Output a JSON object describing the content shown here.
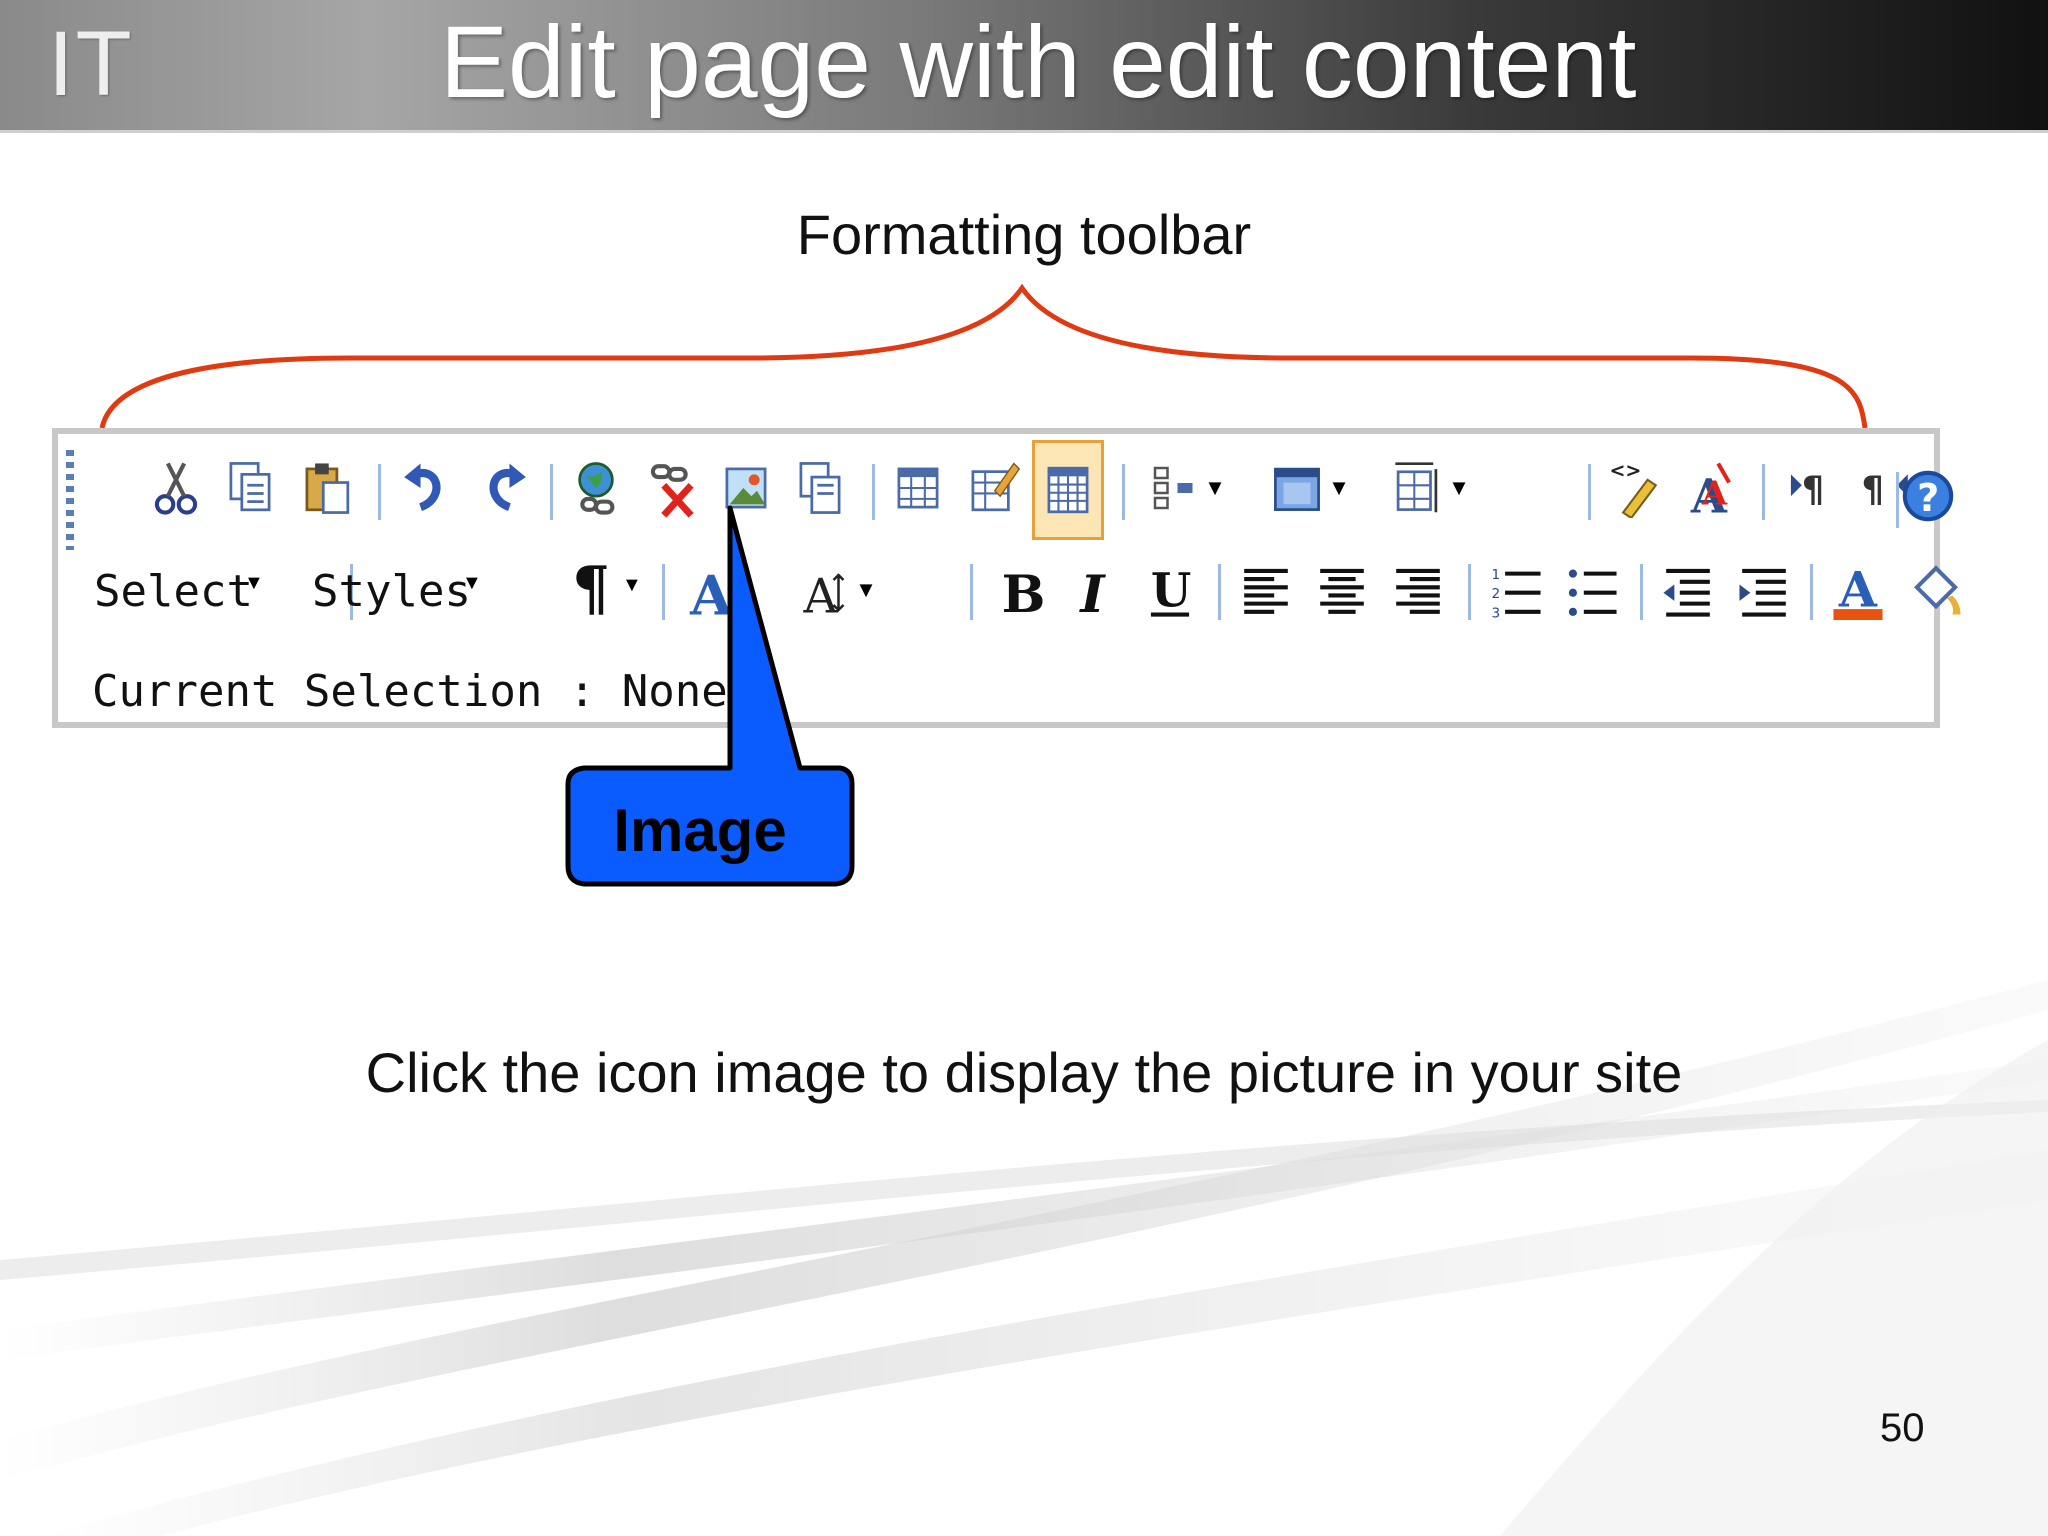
{
  "slide": {
    "logo_text": "IT",
    "title": "Edit page with edit content",
    "toolbar_caption": "Formatting toolbar",
    "body_text": "Click the icon image to display the picture in your site",
    "page_number": "50"
  },
  "toolbar": {
    "style_select_label": "Select",
    "styles_select_label": "Styles",
    "paragraph_symbol": "¶",
    "status_line": "Current Selection : None",
    "row1_icons": [
      "cut-icon",
      "copy-icon",
      "paste-icon",
      "undo-icon",
      "redo-icon",
      "hyperlink-icon",
      "remove-link-icon",
      "image-icon",
      "media-icon",
      "table-icon",
      "edit-form-icon",
      "table-properties-icon",
      "insert-row-icon",
      "insert-column-icon",
      "merge-cells-icon",
      "html-edit-icon",
      "spell-check-icon",
      "ltr-icon",
      "rtl-icon",
      "help-icon"
    ],
    "row2_icons": [
      "font-icon",
      "font-size-icon",
      "bold-icon",
      "italic-icon",
      "underline-icon",
      "align-left-icon",
      "align-center-icon",
      "align-right-icon",
      "numbered-list-icon",
      "bulleted-list-icon",
      "outdent-icon",
      "indent-icon",
      "font-color-icon",
      "highlight-icon"
    ]
  },
  "callout": {
    "label": "Image",
    "fill_color": "#0b5cff"
  },
  "colors": {
    "brace": "#e03a12",
    "font_color_bar": "#e8540f",
    "separator": "#9bbbe2"
  }
}
